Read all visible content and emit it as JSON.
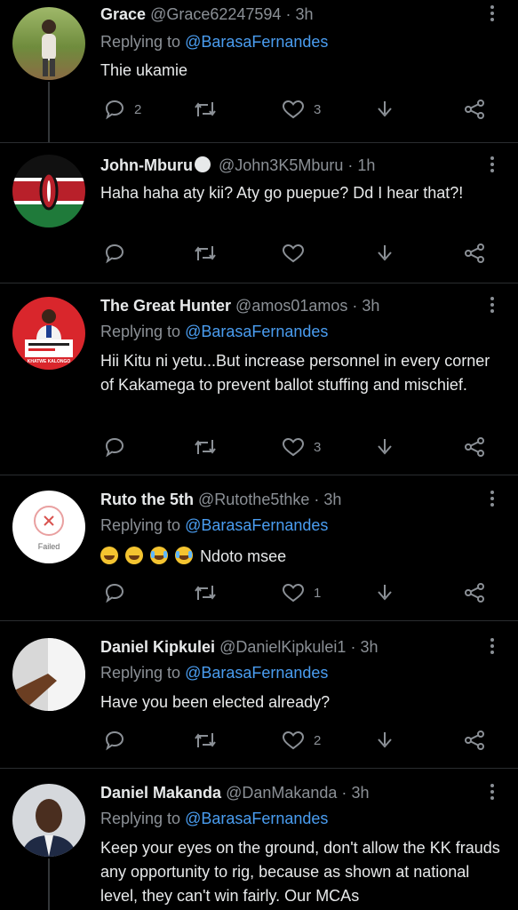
{
  "tweets": [
    {
      "name": "Grace",
      "handle": "@Grace62247594",
      "dot": "·",
      "time": "3h",
      "replying_label": "Replying to",
      "mention": "@BarasaFernandes",
      "text": "Thie ukamie",
      "counts": {
        "reply": "2",
        "retweet": "",
        "like": "3"
      }
    },
    {
      "name": "John-Mburu",
      "handle": "@John3K5Mburu",
      "dot": "·",
      "time": "1h",
      "text": "Haha haha aty kii? Aty go puepue? Dd I hear that?!",
      "counts": {
        "reply": "",
        "retweet": "",
        "like": ""
      }
    },
    {
      "name": "The Great Hunter",
      "handle": "@amos01amos",
      "dot": "·",
      "time": "3h",
      "replying_label": "Replying to",
      "mention": "@BarasaFernandes",
      "text": "Hii Kitu ni yetu...But increase personnel in every corner of Kakamega to prevent ballot stuffing and mischief.",
      "counts": {
        "reply": "",
        "retweet": "",
        "like": "3"
      },
      "avatar_caption": "KHATWE KALONGO"
    },
    {
      "name": "Ruto the 5th",
      "handle": "@Rutothe5thke",
      "dot": "·",
      "time": "3h",
      "replying_label": "Replying to",
      "mention": "@BarasaFernandes",
      "text": "Ndoto msee",
      "counts": {
        "reply": "",
        "retweet": "",
        "like": "1"
      },
      "avatar_failed": "Failed"
    },
    {
      "name": "Daniel Kipkulei",
      "handle": "@DanielKipkulei1",
      "dot": "·",
      "time": "3h",
      "replying_label": "Replying to",
      "mention": "@BarasaFernandes",
      "text": "Have you been elected already?",
      "counts": {
        "reply": "",
        "retweet": "",
        "like": "2"
      }
    },
    {
      "name": "Daniel Makanda",
      "handle": "@DanMakanda",
      "dot": "·",
      "time": "3h",
      "replying_label": "Replying to",
      "mention": "@BarasaFernandes",
      "text": "Keep your eyes on the ground, don't allow the KK frauds any opportunity to rig, because as shown at national level, they can't win fairly. Our MCAs"
    }
  ],
  "icons": {
    "reply": "reply-icon",
    "retweet": "retweet-icon",
    "like": "heart-icon",
    "download": "download-icon",
    "share": "share-icon",
    "more": "more-icon"
  },
  "colors": {
    "background": "#000000",
    "primary_text": "#e7e9ea",
    "secondary_text": "#8b9096",
    "mention": "#4a9df0",
    "divider": "#2a2d30"
  }
}
